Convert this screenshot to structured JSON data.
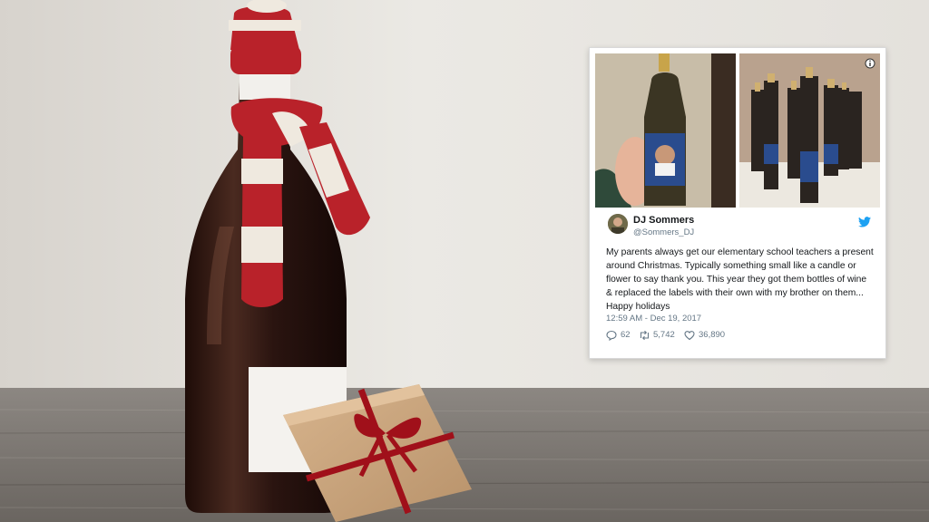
{
  "tweet": {
    "display_name": "DJ Sommers",
    "handle": "@Sommers_DJ",
    "text": "My parents always get our elementary school teachers a present around Christmas. Typically something small like a candle or flower to say thank you. This year they got them bottles of wine & replaced the labels with their own with my brother on them... Happy holidays",
    "timestamp": "12:59 AM - Dec 19, 2017",
    "replies": "62",
    "retweets": "5,742",
    "likes": "36,890"
  },
  "colors": {
    "wall": "#e6e3de",
    "table": "#7d7873",
    "bottle": "#2a1410",
    "scarf_red": "#b9222a",
    "scarf_white": "#efe9df",
    "kraft_paper": "#c9a47c",
    "ribbon": "#a0101a",
    "twitter_blue": "#1da1f2"
  },
  "icons": [
    "info-icon",
    "twitter-bird-icon",
    "reply-icon",
    "retweet-icon",
    "heart-icon"
  ]
}
